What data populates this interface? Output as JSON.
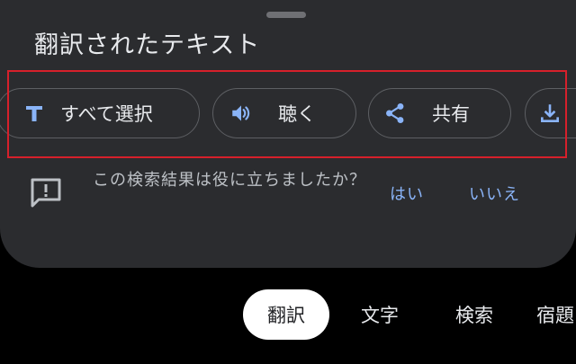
{
  "sheet": {
    "title": "翻訳されたテキスト"
  },
  "actions": {
    "select_all": {
      "label": "すべて選択",
      "icon": "text-T-icon"
    },
    "listen": {
      "label": "聴く",
      "icon": "speaker-icon"
    },
    "share": {
      "label": "共有",
      "icon": "share-icon"
    },
    "download": {
      "label": "",
      "icon": "download-icon"
    }
  },
  "feedback": {
    "question": "この検索結果は役に立ちましたか？",
    "yes": "はい",
    "no": "いいえ",
    "icon": "feedback-icon"
  },
  "bottom_nav": {
    "translate": "翻訳",
    "text": "文字",
    "search": "検索",
    "homework": "宿題"
  },
  "colors": {
    "sheet_bg": "#2b2c2f",
    "accent_blue": "#8ab4f8",
    "highlight_red": "#d6202b",
    "active_tab_bg": "#ffffff"
  }
}
